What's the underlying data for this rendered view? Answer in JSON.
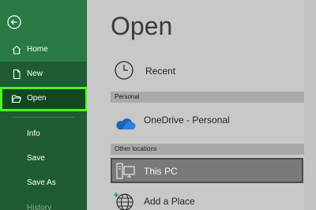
{
  "sidebar": {
    "back_icon": "back-arrow-icon",
    "items": [
      {
        "label": "Home",
        "icon": "home-icon"
      },
      {
        "label": "New",
        "icon": "new-document-icon"
      },
      {
        "label": "Open",
        "icon": "folder-open-icon",
        "selected": true
      },
      {
        "label": "Info"
      },
      {
        "label": "Save"
      },
      {
        "label": "Save As"
      },
      {
        "label": "History"
      }
    ],
    "colors": {
      "background": "#1f5c33",
      "upper": "#2a7a46",
      "selected": "#12481f",
      "highlight": "#4df51c"
    }
  },
  "main": {
    "title": "Open",
    "recent": {
      "label": "Recent",
      "icon": "clock-icon"
    },
    "sections": [
      {
        "header": "Personal",
        "items": [
          {
            "label": "OneDrive - Personal",
            "icon": "cloud-icon"
          }
        ]
      },
      {
        "header": "Other locations",
        "items": [
          {
            "label": "This PC",
            "icon": "computer-icon",
            "selected": true
          },
          {
            "label": "Add a Place",
            "icon": "globe-plus-icon"
          }
        ]
      }
    ]
  }
}
